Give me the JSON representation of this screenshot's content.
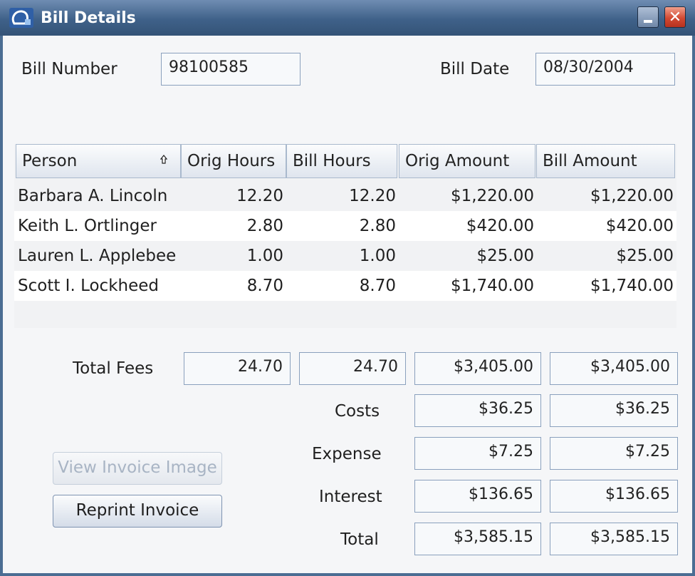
{
  "window": {
    "title": "Bill Details",
    "close_glyph": "✕"
  },
  "bill_number": {
    "label": "Bill Number",
    "value": "98100585"
  },
  "bill_date": {
    "label": "Bill Date",
    "value": "08/30/2004"
  },
  "table": {
    "columns": [
      "Person",
      "Orig Hours",
      "Bill Hours",
      "Orig Amount",
      "Bill Amount"
    ],
    "rows": [
      {
        "person": "Barbara A. Lincoln",
        "orig_hours": "12.20",
        "bill_hours": "12.20",
        "orig_amount": "$1,220.00",
        "bill_amount": "$1,220.00"
      },
      {
        "person": "Keith L. Ortlinger",
        "orig_hours": "2.80",
        "bill_hours": "2.80",
        "orig_amount": "$420.00",
        "bill_amount": "$420.00"
      },
      {
        "person": "Lauren L. Applebee",
        "orig_hours": "1.00",
        "bill_hours": "1.00",
        "orig_amount": "$25.00",
        "bill_amount": "$25.00"
      },
      {
        "person": "Scott I. Lockheed",
        "orig_hours": "8.70",
        "bill_hours": "8.70",
        "orig_amount": "$1,740.00",
        "bill_amount": "$1,740.00"
      }
    ]
  },
  "totals": {
    "total_fees": {
      "label": "Total Fees",
      "orig_hours": "24.70",
      "bill_hours": "24.70",
      "orig_amount": "$3,405.00",
      "bill_amount": "$3,405.00"
    },
    "costs": {
      "label": "Costs",
      "orig_amount": "$36.25",
      "bill_amount": "$36.25"
    },
    "expense": {
      "label": "Expense",
      "orig_amount": "$7.25",
      "bill_amount": "$7.25"
    },
    "interest": {
      "label": "Interest",
      "orig_amount": "$136.65",
      "bill_amount": "$136.65"
    },
    "total": {
      "label": "Total",
      "orig_amount": "$3,585.15",
      "bill_amount": "$3,585.15"
    }
  },
  "buttons": {
    "view_invoice": "View Invoice Image",
    "reprint_invoice": "Reprint Invoice"
  },
  "icons": {
    "app": "app-logo-icon",
    "sort": "sort-ascending-icon",
    "minimize": "minimize-icon",
    "close": "close-icon"
  },
  "colors": {
    "titlebar": "#3f6189",
    "close_button": "#d24a33",
    "field_border": "#8aa0bd"
  }
}
